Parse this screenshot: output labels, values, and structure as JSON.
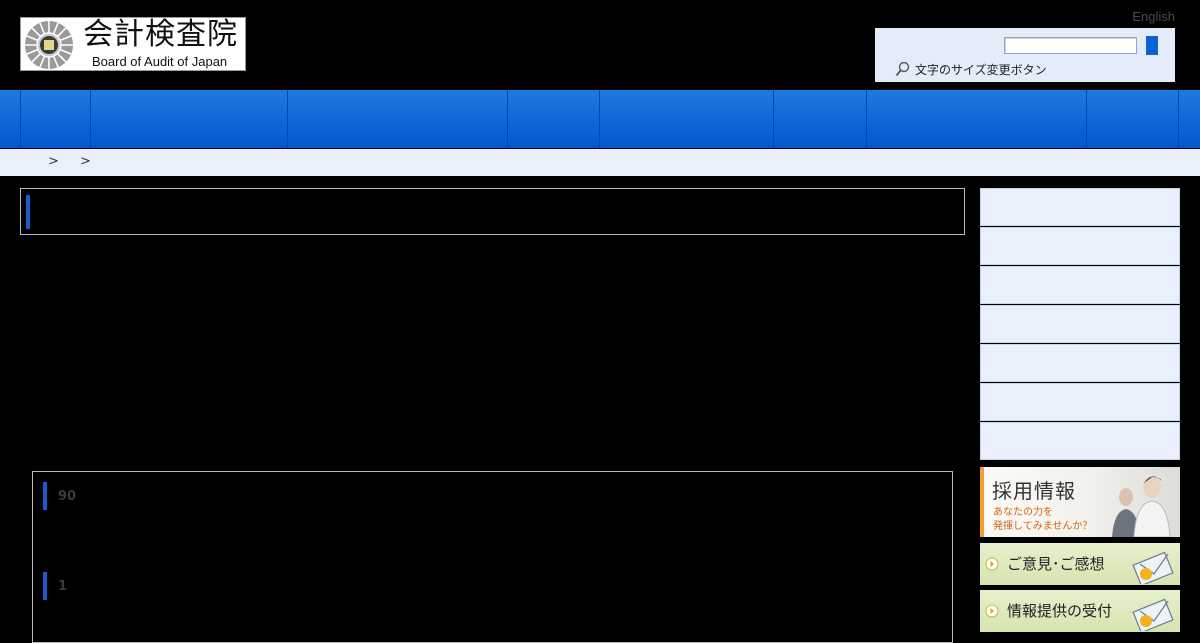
{
  "header": {
    "logo_jp": "会計検査院",
    "logo_en": "Board of Audit of Japan",
    "english_link": "English",
    "search": {
      "value": "",
      "placeholder": ""
    },
    "font_size_label": "文字のサイズ変更ボタン"
  },
  "breadcrumb": {
    "separators": [
      ">",
      ">"
    ]
  },
  "main": {
    "sections": [
      {
        "number": "90"
      },
      {
        "number": "1"
      }
    ]
  },
  "sidebar": {
    "recruit": {
      "title": "採用情報",
      "line1": "あなたの力を",
      "line2": "発揮してみませんか？"
    },
    "opinion_label": "ご意見･ご感想",
    "info_label": "情報提供の受付"
  },
  "colors": {
    "nav_blue": "#0a63d3",
    "accent_bar": "#1a5ccf",
    "light_panel": "#e9f0fb",
    "green_banner": "#d5e4b0",
    "recruit_orange": "#f1a02f"
  },
  "icons": [
    "seal-logo-icon",
    "search-button-icon",
    "magnifier-icon",
    "people-photo-icon",
    "mail-icon",
    "arrow-circle-icon"
  ]
}
